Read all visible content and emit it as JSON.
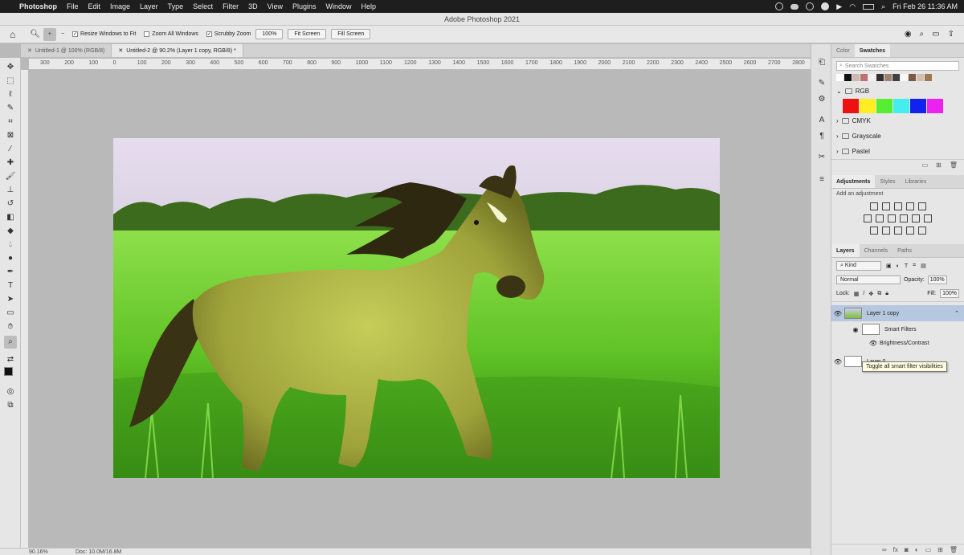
{
  "mac_menu": {
    "app": "Photoshop",
    "items": [
      "File",
      "Edit",
      "Image",
      "Layer",
      "Type",
      "Select",
      "Filter",
      "3D",
      "View",
      "Plugins",
      "Window",
      "Help"
    ],
    "clock": "Fri Feb 26  11:36 AM"
  },
  "window_title": "Adobe Photoshop 2021",
  "options_bar": {
    "resize_windows": "Resize Windows to Fit",
    "zoom_all": "Zoom All Windows",
    "scrubby_zoom": "Scrubby Zoom",
    "zoom_100": "100%",
    "fit_screen": "Fit Screen",
    "fill_screen": "Fill Screen"
  },
  "doc_tabs": [
    {
      "label": "Untitled-1 @ 100% (RGB/8)"
    },
    {
      "label": "Untitled-2 @ 90.2% (Layer 1 copy, RGB/8) *"
    }
  ],
  "ruler_ticks": [
    "300",
    "200",
    "100",
    "0",
    "100",
    "200",
    "300",
    "400",
    "500",
    "600",
    "700",
    "800",
    "900",
    "1000",
    "1100",
    "1200",
    "1300",
    "1400",
    "1500",
    "1600",
    "1700",
    "1800",
    "1900",
    "2000",
    "2100",
    "2200",
    "2300",
    "2400",
    "2500",
    "2600",
    "2700",
    "2800"
  ],
  "status_bar": {
    "zoom": "90.16%",
    "doc": "Doc: 10.0M/16.8M"
  },
  "swatches_panel": {
    "tabs": [
      "Color",
      "Swatches"
    ],
    "search_placeholder": "Search Swatches",
    "recent_colors": [
      "#ffffff",
      "#111111",
      "#c8b8b0",
      "#c07070",
      "#f0f0f0",
      "#303030",
      "#a08070",
      "#404040",
      "#f8f8f8",
      "#7a5a40",
      "#d0c0b0",
      "#a07850"
    ],
    "groups": [
      "RGB",
      "CMYK",
      "Grayscale",
      "Pastel"
    ],
    "rgb_colors": [
      "#ee1111",
      "#ffee22",
      "#55ee33",
      "#44eeee",
      "#1122ee",
      "#ee22ee"
    ]
  },
  "adjustments_panel": {
    "tabs": [
      "Adjustments",
      "Styles",
      "Libraries"
    ],
    "hint": "Add an adjustment"
  },
  "layers_panel": {
    "tabs": [
      "Layers",
      "Channels",
      "Paths"
    ],
    "filter_kind": "Kind",
    "blend_mode": "Normal",
    "opacity_label": "Opacity:",
    "opacity_value": "100%",
    "lock_label": "Lock:",
    "fill_label": "Fill:",
    "fill_value": "100%",
    "layers": [
      {
        "name": "Layer 1 copy"
      },
      {
        "name": "Smart Filters"
      },
      {
        "name": "Brightness/Contrast"
      },
      {
        "name": "Layer 0"
      }
    ],
    "tooltip": "Toggle all smart filter visibilities"
  }
}
